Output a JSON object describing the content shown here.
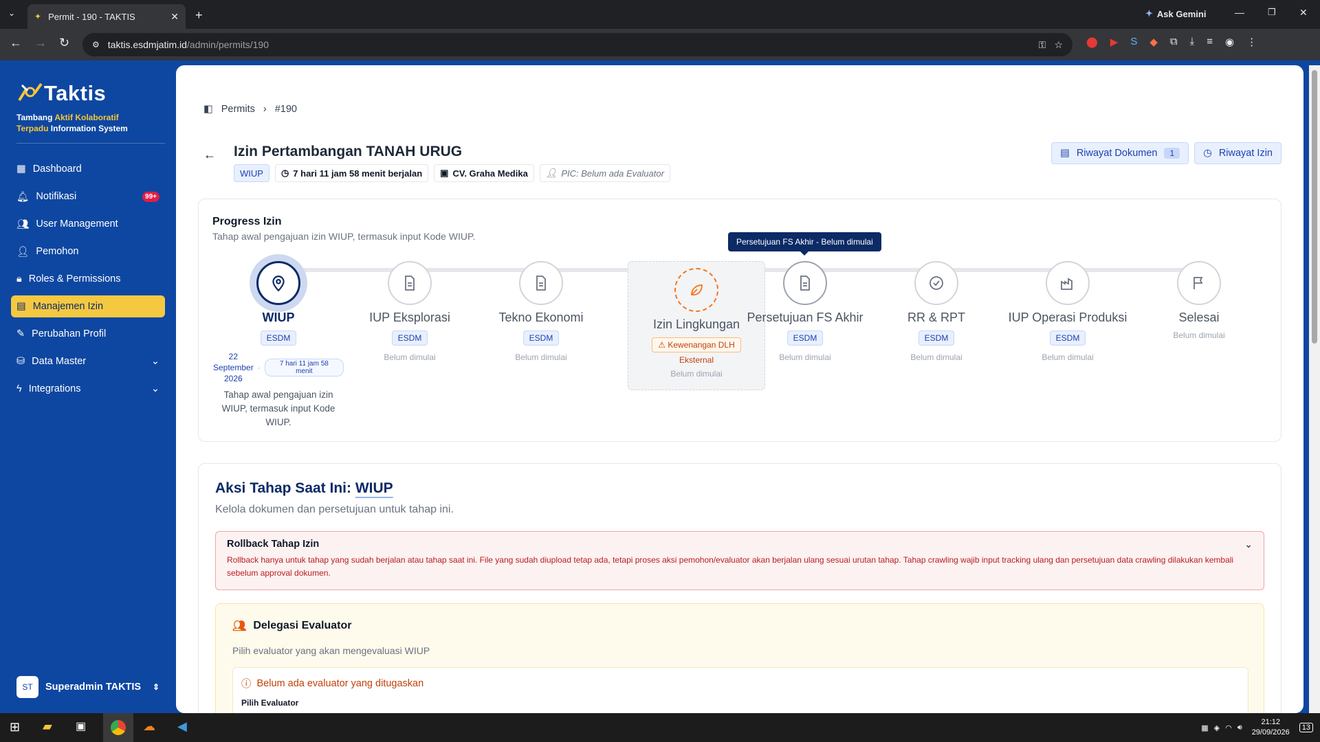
{
  "browser": {
    "tab_title": "Permit - 190 - TAKTIS",
    "url_host": "taktis.esdmjatim.id",
    "url_path": "/admin/permits/190",
    "ask_gemini": "Ask Gemini"
  },
  "sidebar": {
    "logo": "Taktis",
    "tagline_part1": "Tambang ",
    "tagline_highlight1": "Aktif Kolaboratif",
    "tagline_highlight2": "Terpadu",
    "tagline_part2": " Information System",
    "items": [
      {
        "label": "Dashboard",
        "icon": "grid-icon"
      },
      {
        "label": "Notifikasi",
        "icon": "bell-icon",
        "badge": "99+"
      },
      {
        "label": "User Management",
        "icon": "users-icon"
      },
      {
        "label": "Pemohon",
        "icon": "user-check-icon"
      },
      {
        "label": "Roles & Permissions",
        "icon": "lock-icon"
      },
      {
        "label": "Manajemen Izin",
        "icon": "document-icon",
        "active": true
      },
      {
        "label": "Perubahan Profil",
        "icon": "file-edit-icon"
      },
      {
        "label": "Data Master",
        "icon": "database-icon"
      },
      {
        "label": "Integrations",
        "icon": "zap-icon"
      }
    ],
    "user": {
      "initials": "ST",
      "name": "Superadmin TAKTIS"
    }
  },
  "header": {
    "breadcrumb": {
      "root": "Permits",
      "current": "#190"
    },
    "title": "Izin Pertambangan TANAH URUG",
    "chips": {
      "type": "WIUP",
      "timer": "7 hari 11 jam 58 menit berjalan",
      "company": "CV. Graha Medika",
      "pic": "PIC: Belum ada Evaluator"
    },
    "buttons": {
      "doc_history": "Riwayat Dokumen",
      "doc_count": "1",
      "permit_history": "Riwayat Izin"
    }
  },
  "progress": {
    "title": "Progress Izin",
    "subtitle": "Tahap awal pengajuan izin WIUP, termasuk input Kode WIUP.",
    "tooltip": "Persetujuan FS Akhir - Belum dimulai",
    "steps": [
      {
        "name": "WIUP",
        "agency": "ESDM",
        "date_line1": "22",
        "date_line2": "September",
        "date_line3": "2026",
        "duration": "7 hari 11 jam 58 menit",
        "desc": "Tahap awal pengajuan izin WIUP, termasuk input Kode WIUP."
      },
      {
        "name": "IUP Eksplorasi",
        "agency": "ESDM",
        "status": "Belum dimulai"
      },
      {
        "name": "Tekno Ekonomi",
        "agency": "ESDM",
        "status": "Belum dimulai"
      },
      {
        "name": "Izin Lingkungan",
        "agency": "Kewenangan DLH",
        "agency_note": "Eksternal",
        "status": "Belum dimulai"
      },
      {
        "name": "Persetujuan FS Akhir",
        "agency": "ESDM",
        "status": "Belum dimulai"
      },
      {
        "name": "RR & RPT",
        "agency": "ESDM",
        "status": "Belum dimulai"
      },
      {
        "name": "IUP Operasi Produksi",
        "agency": "ESDM",
        "status": "Belum dimulai"
      },
      {
        "name": "Selesai",
        "status": "Belum dimulai"
      }
    ]
  },
  "action": {
    "title_prefix": "Aksi Tahap Saat Ini:",
    "title_stage": "WIUP",
    "subtitle": "Kelola dokumen dan persetujuan untuk tahap ini.",
    "rollback": {
      "title": "Rollback Tahap Izin",
      "desc": "Rollback hanya untuk tahap yang sudah berjalan atau tahap saat ini. File yang sudah diupload tetap ada, tetapi proses aksi pemohon/evaluator akan berjalan ulang sesuai urutan tahap. Tahap crawling wajib input tracking ulang dan persetujuan data crawling dilakukan kembali sebelum approval dokumen."
    },
    "delegation": {
      "title": "Delegasi Evaluator",
      "subtitle": "Pilih evaluator yang akan mengevaluasi WIUP",
      "warning": "Belum ada evaluator yang ditugaskan",
      "field_label": "Pilih Evaluator"
    }
  },
  "taskbar": {
    "time": "21:12",
    "date": "29/09/2026",
    "notif_count": "13"
  },
  "colors": {
    "brand": "#0e47a1",
    "accent": "#f5c842",
    "danger": "#e11d48"
  }
}
